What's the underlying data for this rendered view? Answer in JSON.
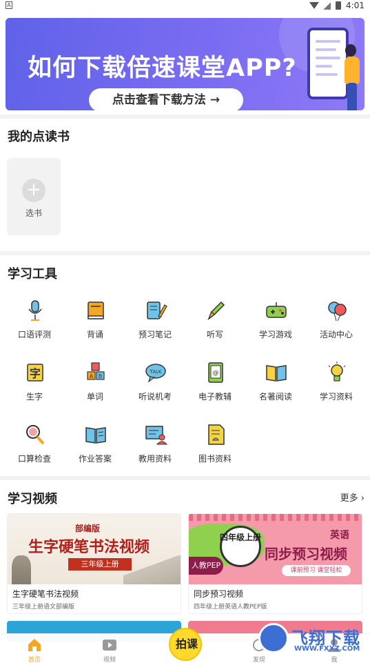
{
  "status_bar": {
    "left_icon": "A",
    "time": "4:01"
  },
  "banner": {
    "title": "如何下载倍速课堂APP?",
    "button": "点击查看下载方法 →",
    "dots": 4,
    "active_dot": 0,
    "colors": {
      "bg": "#6b67ee",
      "dot_active": "#ffc21c"
    }
  },
  "my_books": {
    "title": "我的点读书",
    "add_label": "选书"
  },
  "tools": {
    "title": "学习工具",
    "items": [
      {
        "label": "口语评测",
        "icon": "microphone-icon"
      },
      {
        "label": "背诵",
        "icon": "book-icon"
      },
      {
        "label": "预习笔记",
        "icon": "notebook-pen-icon"
      },
      {
        "label": "听写",
        "icon": "pencil-icon"
      },
      {
        "label": "学习游戏",
        "icon": "gamepad-icon"
      },
      {
        "label": "活动中心",
        "icon": "balloons-icon"
      },
      {
        "label": "生字",
        "icon": "character-card-icon"
      },
      {
        "label": "单词",
        "icon": "letter-blocks-icon"
      },
      {
        "label": "听说机考",
        "icon": "talk-bubble-icon"
      },
      {
        "label": "电子教辅",
        "icon": "ebook-icon"
      },
      {
        "label": "名著阅读",
        "icon": "open-book-icon"
      },
      {
        "label": "学习资料",
        "icon": "lightbulb-icon"
      },
      {
        "label": "口算检查",
        "icon": "magnifier-icon"
      },
      {
        "label": "作业答案",
        "icon": "answer-book-icon"
      },
      {
        "label": "教用资料",
        "icon": "teacher-board-icon"
      },
      {
        "label": "图书资料",
        "icon": "document-icon"
      }
    ]
  },
  "videos": {
    "title": "学习视频",
    "more": "更多",
    "cards": [
      {
        "thumb_badge": "部编版",
        "thumb_title": "生字硬笔书法视频",
        "thumb_ribbon": "三年级上册",
        "title": "生字硬笔书法视频",
        "subtitle": "三年级上册语文部编版"
      },
      {
        "thumb_grade": "四年级上册",
        "thumb_pep": "人教PEP",
        "thumb_subject": "英语",
        "thumb_title": "同步预习视频",
        "thumb_pill": "课前预习 课堂轻松",
        "title": "同步预习视频",
        "subtitle": "四年级上册英语人教PEP版"
      }
    ]
  },
  "bottom_nav": {
    "items": [
      {
        "label": "首页",
        "icon": "home-icon",
        "active": true
      },
      {
        "label": "视频",
        "icon": "video-play-icon",
        "active": false
      },
      {
        "label": "发现",
        "icon": "discover-icon",
        "active": false
      },
      {
        "label": "我",
        "icon": "user-icon",
        "active": false
      }
    ],
    "center_label": "拍课"
  },
  "watermark": {
    "text": "飞翔下载",
    "url": "WWW.FXXZ.COM"
  }
}
